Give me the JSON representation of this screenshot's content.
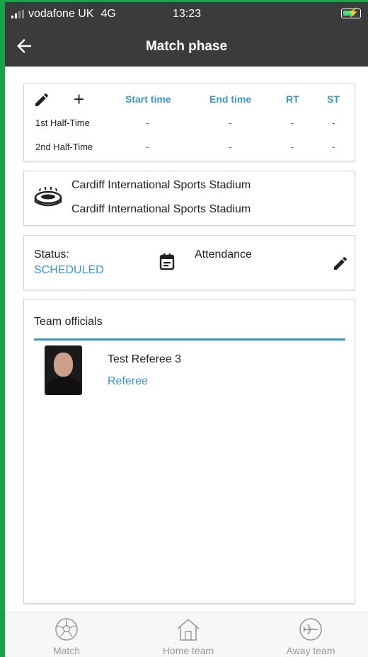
{
  "status_bar": {
    "carrier": "vodafone UK",
    "network": "4G",
    "time": "13:23"
  },
  "app_bar": {
    "title": "Match phase"
  },
  "periods": {
    "columns": [
      "Start time",
      "End time",
      "RT",
      "ST"
    ],
    "rows": [
      {
        "label": "1st Half-Time",
        "values": [
          "-",
          "-",
          "-",
          "-"
        ]
      },
      {
        "label": "2nd Half-Time",
        "values": [
          "-",
          "-",
          "-",
          "-"
        ]
      }
    ]
  },
  "stadium": {
    "line1": "Cardiff International Sports Stadium",
    "line2": "Cardiff International Sports Stadium"
  },
  "status": {
    "label": "Status:",
    "value": "SCHEDULED",
    "attendance_label": "Attendance"
  },
  "officials": {
    "header": "Team officials",
    "items": [
      {
        "name": "Test Referee 3",
        "role": "Referee"
      }
    ]
  },
  "bottom_nav": {
    "match": "Match",
    "home": "Home team",
    "away": "Away team"
  },
  "colors": {
    "accent": "#3b97d3",
    "app_bar": "#3b3b3b"
  }
}
